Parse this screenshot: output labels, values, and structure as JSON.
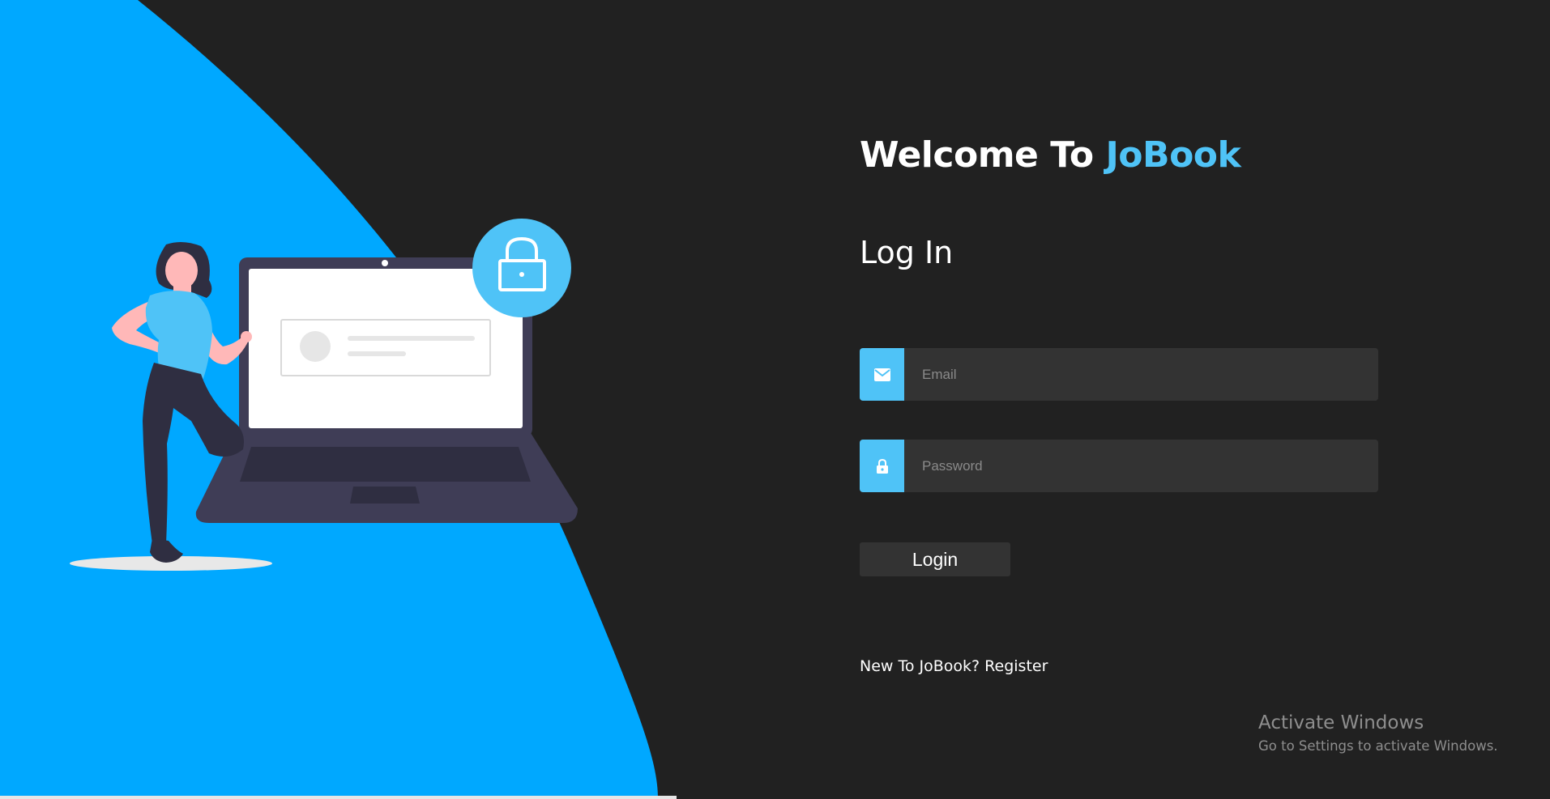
{
  "welcome": {
    "prefix": "Welcome To ",
    "brand": "JoBook"
  },
  "login": {
    "title": "Log In",
    "email": {
      "placeholder": "Email",
      "value": "",
      "icon": "mail-icon"
    },
    "password": {
      "placeholder": "Password",
      "value": "",
      "icon": "lock-icon"
    },
    "submit_label": "Login"
  },
  "register": {
    "prompt": "New To JoBook? ",
    "link_label": "Register"
  },
  "watermark": {
    "title": "Activate Windows",
    "subtitle": "Go to Settings to activate Windows."
  },
  "colors": {
    "background": "#212121",
    "accent": "#4fc3f7",
    "blob": "#00a8ff",
    "input": "#333333"
  }
}
